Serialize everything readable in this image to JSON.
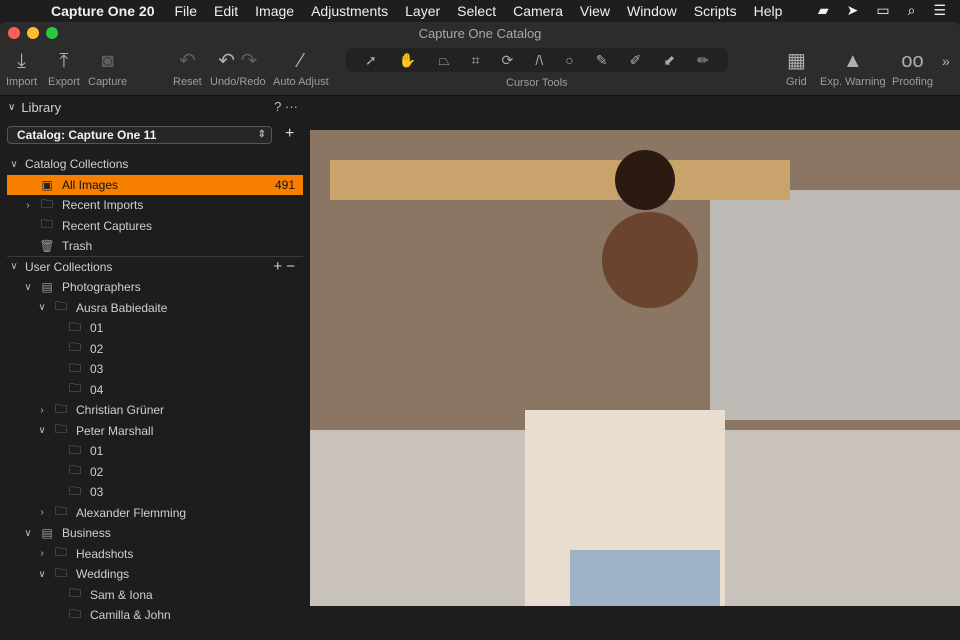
{
  "menubar": {
    "app": "Capture One 20",
    "items": [
      "File",
      "Edit",
      "Image",
      "Adjustments",
      "Layer",
      "Select",
      "Camera",
      "View",
      "Window",
      "Scripts",
      "Help"
    ]
  },
  "window": {
    "title": "Capture One Catalog"
  },
  "toolbar": {
    "import": "Import",
    "export": "Export",
    "capture": "Capture",
    "reset": "Reset",
    "undo_redo": "Undo/Redo",
    "auto_adjust": "Auto Adjust",
    "cursor_tools": "Cursor Tools",
    "grid": "Grid",
    "exp_warning": "Exp. Warning",
    "proofing": "Proofing"
  },
  "library": {
    "title": "Library",
    "help": "?",
    "more": "···",
    "catalog": "Catalog: Capture One 11"
  },
  "tree": [
    {
      "label": "Catalog Collections",
      "x": 0,
      "chev": "v",
      "icon": "",
      "header": true
    },
    {
      "label": "All Images",
      "x": 1,
      "chev": "",
      "icon": "all-images",
      "count": "491",
      "selected": true
    },
    {
      "label": "Recent Imports",
      "x": 1,
      "chev": ">",
      "icon": "folder"
    },
    {
      "label": "Recent Captures",
      "x": 1,
      "chev": "",
      "icon": "folder"
    },
    {
      "label": "Trash",
      "x": 1,
      "chev": "",
      "icon": "trash"
    },
    {
      "label": "User Collections",
      "x": 0,
      "chev": "v",
      "icon": "",
      "header": true,
      "actions": "+ −"
    },
    {
      "label": "Photographers",
      "x": 1,
      "chev": "v",
      "icon": "project"
    },
    {
      "label": "Ausra Babiedaite",
      "x": 2,
      "chev": "v",
      "icon": "folder"
    },
    {
      "label": "01",
      "x": 3,
      "chev": "",
      "icon": "folder"
    },
    {
      "label": "02",
      "x": 3,
      "chev": "",
      "icon": "folder"
    },
    {
      "label": "03",
      "x": 3,
      "chev": "",
      "icon": "folder"
    },
    {
      "label": "04",
      "x": 3,
      "chev": "",
      "icon": "folder"
    },
    {
      "label": "Christian Grüner",
      "x": 2,
      "chev": ">",
      "icon": "folder"
    },
    {
      "label": "Peter Marshall",
      "x": 2,
      "chev": "v",
      "icon": "folder"
    },
    {
      "label": "01",
      "x": 3,
      "chev": "",
      "icon": "folder"
    },
    {
      "label": "02",
      "x": 3,
      "chev": "",
      "icon": "folder"
    },
    {
      "label": "03",
      "x": 3,
      "chev": "",
      "icon": "folder"
    },
    {
      "label": "Alexander Flemming",
      "x": 2,
      "chev": ">",
      "icon": "folder"
    },
    {
      "label": "Business",
      "x": 1,
      "chev": "v",
      "icon": "project"
    },
    {
      "label": "Headshots",
      "x": 2,
      "chev": ">",
      "icon": "folder"
    },
    {
      "label": "Weddings",
      "x": 2,
      "chev": "v",
      "icon": "folder"
    },
    {
      "label": "Sam & Iona",
      "x": 3,
      "chev": "",
      "icon": "folder"
    },
    {
      "label": "Camilla & John",
      "x": 3,
      "chev": "",
      "icon": "folder"
    }
  ],
  "colors": {
    "accent": "#f77f00"
  }
}
